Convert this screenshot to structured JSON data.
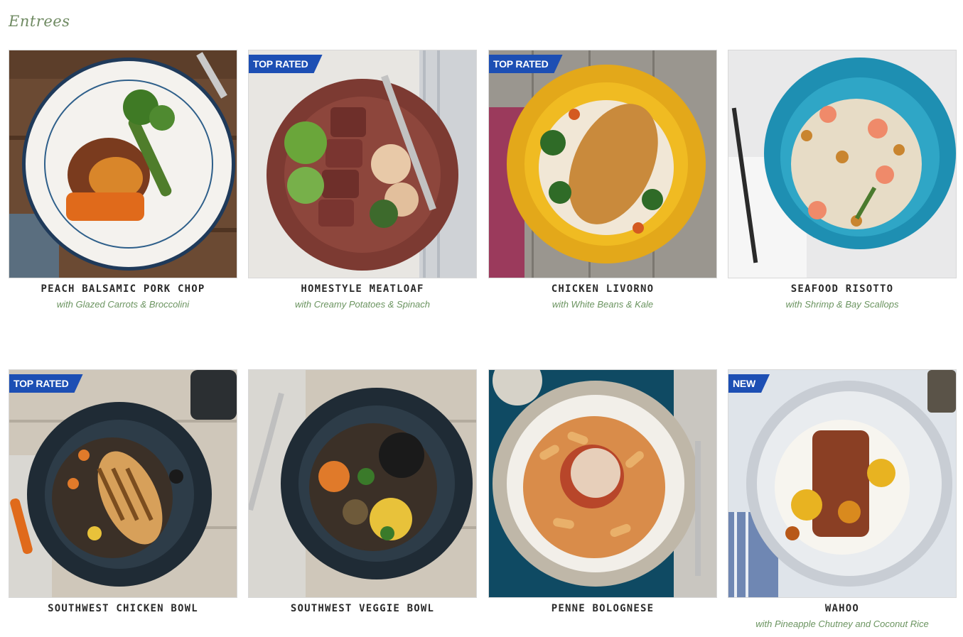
{
  "section": {
    "title": "Entrees"
  },
  "colors": {
    "accent_green": "#6b9460",
    "badge_blue": "#1d4fb4",
    "title_text": "#2a2a2a"
  },
  "entrees": [
    {
      "name": "PEACH BALSAMIC PORK CHOP",
      "subtitle": "with Glazed Carrots & Broccolini",
      "badge": "",
      "image": "pork-chop-plate-image"
    },
    {
      "name": "HOMESTYLE MEATLOAF",
      "subtitle": "with Creamy Potatoes & Spinach",
      "badge": "TOP RATED",
      "image": "meatloaf-plate-image"
    },
    {
      "name": "CHICKEN LIVORNO",
      "subtitle": "with White Beans & Kale",
      "badge": "TOP RATED",
      "image": "chicken-livorno-plate-image"
    },
    {
      "name": "SEAFOOD RISOTTO",
      "subtitle": "with Shrimp & Bay Scallops",
      "badge": "",
      "image": "seafood-risotto-bowl-image"
    },
    {
      "name": "SOUTHWEST CHICKEN BOWL",
      "subtitle": "",
      "badge": "TOP RATED",
      "image": "southwest-chicken-bowl-image"
    },
    {
      "name": "SOUTHWEST VEGGIE BOWL",
      "subtitle": "",
      "badge": "",
      "image": "southwest-veggie-bowl-image"
    },
    {
      "name": "PENNE BOLOGNESE",
      "subtitle": "",
      "badge": "",
      "image": "penne-bolognese-plate-image"
    },
    {
      "name": "WAHOO",
      "subtitle": "with Pineapple Chutney and Coconut Rice",
      "badge": "NEW",
      "image": "wahoo-plate-image"
    }
  ]
}
